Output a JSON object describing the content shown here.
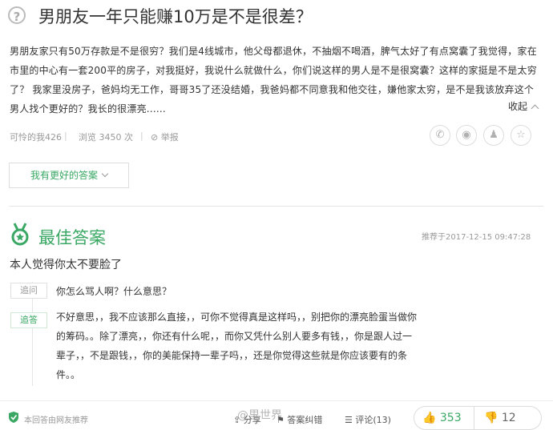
{
  "question": {
    "title": "男朋友一年只能赚10万是不是很差？",
    "body": "男朋友家只有50万存款是不是很穷？我们是4线城市，他父母都退休，不抽烟不喝酒，脾气太好了有点窝囊了我觉得，家在市里的中心有一套200平的房子，对我挺好，我说什么就做什么，你们说这样的男人是不是很窝囊？这样的家挺是不是太穷了？ 我家里没房子，爸妈均无工作，哥哥35了还没结婚，我爸妈都不同意我和他交往，嫌他家太穷，是不是我该放弃这个男人找个更好的？我长的很漂亮......",
    "collapse_label": "收起",
    "author": "可怜的我426",
    "views": "浏览 3450 次",
    "report": "举报"
  },
  "share_icons": [
    "wechat-icon",
    "weibo-icon",
    "qq-icon",
    "star-icon"
  ],
  "better_answer_button": "我有更好的答案",
  "best_answer": {
    "title": "最佳答案",
    "time": "推荐于2017-12-15 09:47:28",
    "text": "本人觉得你太不要脸了",
    "followups": [
      {
        "tag": "追问",
        "text": "你怎么骂人啊？什么意思？"
      },
      {
        "tag": "追答",
        "text": "不好意思，，我不应该那么直接，，可你不觉得真是这样吗，，别把你的漂亮脸蛋当做你的筹码。。除了漂亮，，你还有什么呢，，而你又凭什么别人要多有钱，，你是跟人过一辈子，，不是跟钱，，你的美能保持一辈子吗，，还是你觉得这些就是你应该要有的条件。。"
      }
    ]
  },
  "footer": {
    "recommend": "本回答由网友推荐",
    "share": "分享",
    "collect": "答案纠错",
    "comment": "评论(13)",
    "upvotes": "353",
    "downvotes": "12",
    "watermark": "@里世界"
  },
  "colors": {
    "green": "#3aa864",
    "gray": "#999999"
  }
}
